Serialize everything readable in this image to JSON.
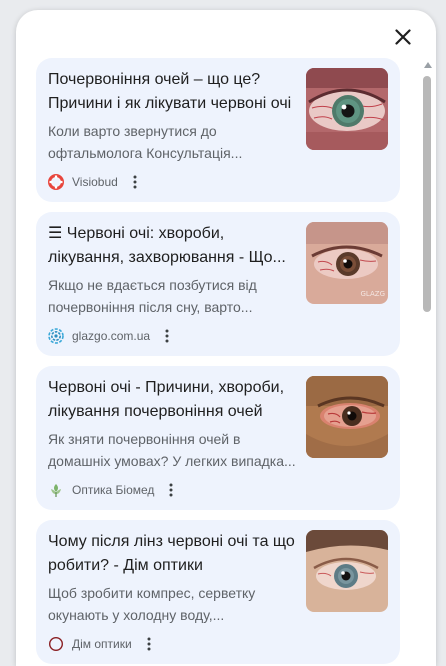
{
  "results": [
    {
      "title": "Почервоніння очей – що це? Причини і як лікувати червоні очі",
      "snippet": "Коли варто звернутися до офтальмолога Консультація...",
      "source": "Visiobud",
      "favicon": "visiobud-lifebuoy-icon",
      "thumbnail": "bloodshot-green-eye"
    },
    {
      "title": "☰ Червоні очі: хвороби, лікування, захворювання - Що...",
      "snippet": "Якщо не вдається позбутися від почервоніння після сну, варто...",
      "source": "glazgo.com.ua",
      "favicon": "glazgo-spiral-icon",
      "thumbnail": "red-veined-brown-eye",
      "watermark": "GLAZG"
    },
    {
      "title": "Червоні очі - Причини, хвороби, лікування почервоніння очей",
      "snippet": "Як зняти почервоніння очей в домашніх умовах? У легких випадка...",
      "source": "Оптика Біомед",
      "favicon": "biomed-leaf-icon",
      "thumbnail": "inflamed-eye-closeup"
    },
    {
      "title": "Чому після лінз червоні очі та що робити? - Дім оптики",
      "snippet": "Щоб зробити компрес, серветку окунають у холодну воду,...",
      "source": "Дім оптики",
      "favicon": "dim-optyky-circle-icon",
      "thumbnail": "eye-with-contact-lens"
    }
  ],
  "colors": {
    "card_bg": "#eef3fd",
    "title": "#1f1f1f",
    "snippet": "#5f6368"
  }
}
